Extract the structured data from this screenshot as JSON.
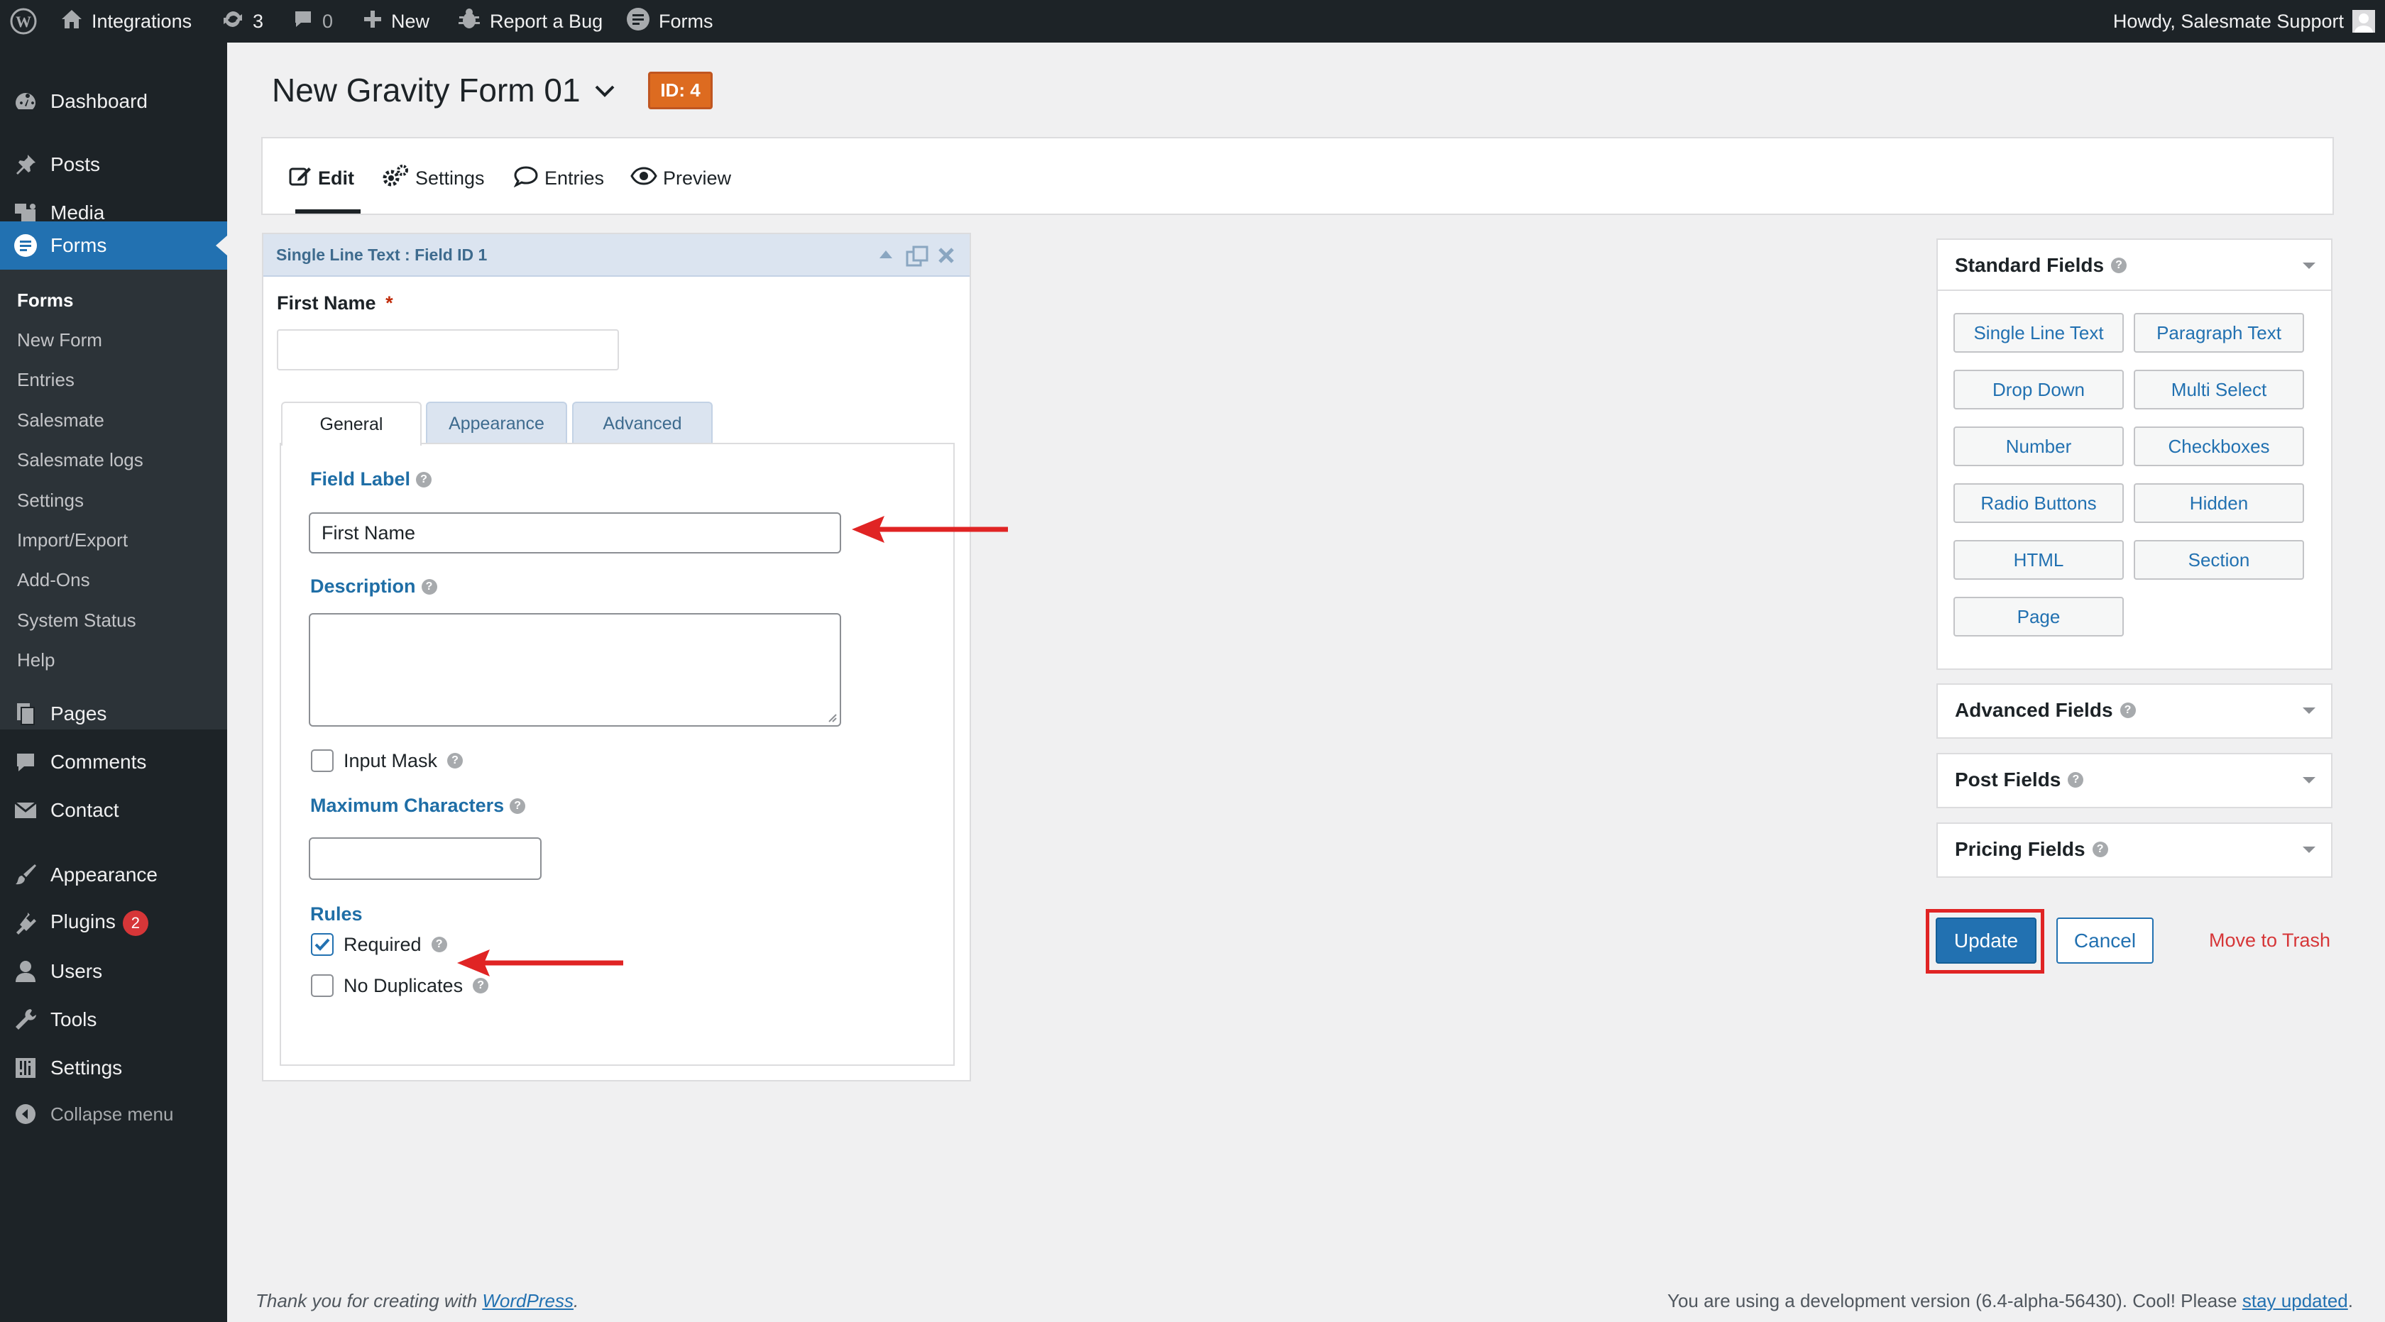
{
  "admin_bar": {
    "site_name": "Integrations",
    "updates_count": "3",
    "comments_count": "0",
    "new_label": "New",
    "report_bug_label": "Report a Bug",
    "forms_label": "Forms",
    "howdy": "Howdy, Salesmate Support"
  },
  "sidebar": {
    "dashboard": "Dashboard",
    "posts": "Posts",
    "media": "Media",
    "forms": "Forms",
    "submenu": [
      "Forms",
      "New Form",
      "Entries",
      "Salesmate",
      "Salesmate logs",
      "Settings",
      "Import/Export",
      "Add-Ons",
      "System Status",
      "Help"
    ],
    "pages": "Pages",
    "comments": "Comments",
    "contact": "Contact",
    "appearance": "Appearance",
    "plugins": "Plugins",
    "plugins_badge": "2",
    "users": "Users",
    "tools": "Tools",
    "settings": "Settings",
    "collapse": "Collapse menu"
  },
  "header": {
    "form_title": "New Gravity Form 01",
    "id_badge": "ID: 4"
  },
  "toolbar": {
    "edit": "Edit",
    "settings": "Settings",
    "entries": "Entries",
    "preview": "Preview"
  },
  "field_panel": {
    "title": "Single Line Text : Field ID 1",
    "preview_label": "First Name",
    "required_mark": "*",
    "tabs": [
      "General",
      "Appearance",
      "Advanced"
    ],
    "field_label_heading": "Field Label",
    "field_label_value": "First Name",
    "description_heading": "Description",
    "input_mask_label": "Input Mask",
    "max_chars_heading": "Maximum Characters",
    "rules_heading": "Rules",
    "required_label": "Required",
    "required_checked": true,
    "no_duplicates_label": "No Duplicates",
    "input_mask_checked": false,
    "no_duplicates_checked": false
  },
  "right_sidebar": {
    "standard_fields_title": "Standard Fields",
    "standard_fields": [
      "Single Line Text",
      "Paragraph Text",
      "Drop Down",
      "Multi Select",
      "Number",
      "Checkboxes",
      "Radio Buttons",
      "Hidden",
      "HTML",
      "Section",
      "Page"
    ],
    "advanced_fields_title": "Advanced Fields",
    "post_fields_title": "Post Fields",
    "pricing_fields_title": "Pricing Fields",
    "update": "Update",
    "cancel": "Cancel",
    "trash": "Move to Trash"
  },
  "footer": {
    "thanks_prefix": "Thank you for creating with ",
    "wordpress_link": "WordPress",
    "thanks_suffix": ".",
    "version_text": "You are using a development version (6.4-alpha-56430). Cool! Please ",
    "stay_updated_link": "stay updated",
    "version_suffix": "."
  },
  "colors": {
    "admin_dark": "#1d2327",
    "wp_blue": "#2271b1",
    "annotation_red": "#e02424",
    "id_badge": "#dd6b20"
  }
}
